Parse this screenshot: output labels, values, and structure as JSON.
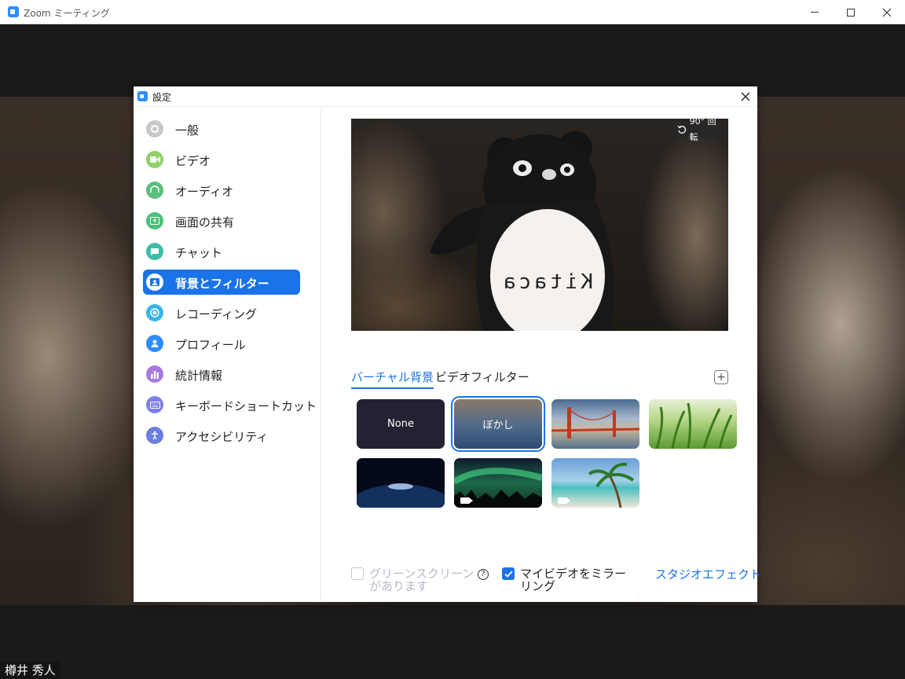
{
  "window": {
    "title": "Zoom ミーティング"
  },
  "participant": {
    "name": "樽井 秀人"
  },
  "dialog": {
    "title": "設定",
    "sidebar": {
      "items": [
        {
          "label": "一般",
          "icon": "gear-icon",
          "color": "#c8c8c8"
        },
        {
          "label": "ビデオ",
          "icon": "video-camera-icon",
          "color": "#8fd16b"
        },
        {
          "label": "オーディオ",
          "icon": "headphones-icon",
          "color": "#5cbf7a"
        },
        {
          "label": "画面の共有",
          "icon": "share-screen-icon",
          "color": "#4cc07a"
        },
        {
          "label": "チャット",
          "icon": "chat-bubble-icon",
          "color": "#3dbda8"
        },
        {
          "label": "背景とフィルター",
          "icon": "background-person-icon",
          "color": "#1a73e8",
          "active": true
        },
        {
          "label": "レコーディング",
          "icon": "record-icon",
          "color": "#3ab4e8"
        },
        {
          "label": "プロフィール",
          "icon": "profile-icon",
          "color": "#2d8cff"
        },
        {
          "label": "統計情報",
          "icon": "statistics-icon",
          "color": "#a87ae0"
        },
        {
          "label": "キーボードショートカット",
          "icon": "keyboard-icon",
          "color": "#7e7ee6"
        },
        {
          "label": "アクセシビリティ",
          "icon": "accessibility-icon",
          "color": "#6a7ee0"
        }
      ]
    },
    "preview": {
      "rotate_label": "90° 回転",
      "shirt_text": "Kitaca"
    },
    "tabs": {
      "virtual": "バーチャル背景",
      "filter": "ビデオフィルター"
    },
    "backgrounds": [
      {
        "name": "none",
        "label": "None"
      },
      {
        "name": "blur",
        "label": "ぼかし",
        "selected": true
      },
      {
        "name": "golden-gate",
        "label": ""
      },
      {
        "name": "grass",
        "label": ""
      },
      {
        "name": "earth",
        "label": ""
      },
      {
        "name": "aurora",
        "label": "",
        "video": true
      },
      {
        "name": "beach",
        "label": "",
        "video": true
      }
    ],
    "footer": {
      "green_screen": "グリーンスクリーンがあります",
      "green_screen_checked": false,
      "mirror": "マイビデオをミラーリング",
      "mirror_checked": true,
      "studio_effects": "スタジオエフェクト"
    }
  }
}
